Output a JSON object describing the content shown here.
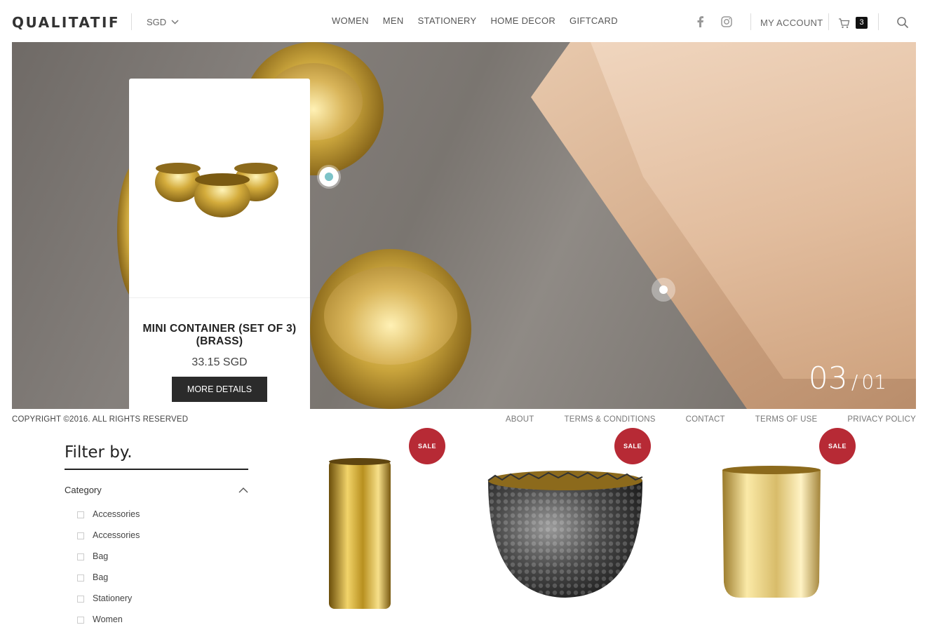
{
  "header": {
    "logo": "QUALITATIF",
    "currency": "SGD",
    "nav": [
      "WOMEN",
      "MEN",
      "STATIONERY",
      "HOME DECOR",
      "GIFTCARD"
    ],
    "account": "MY ACCOUNT",
    "cart_count": "3",
    "icons": [
      "facebook-icon",
      "instagram-icon",
      "cart-icon",
      "search-icon"
    ]
  },
  "hero": {
    "counter_current": "03",
    "counter_sep": "/",
    "counter_total": "01",
    "hotspot_colors": [
      "#7cc3c8",
      "#ffffff"
    ]
  },
  "card": {
    "title": "MINI CONTAINER (SET OF 3) (BRASS)",
    "price": "33.15 SGD",
    "button": "MORE DETAILS"
  },
  "footer": {
    "copyright": "COPYRIGHT ©2016. ALL RIGHTS RESERVED",
    "links": [
      "ABOUT",
      "TERMS & CONDITIONS",
      "CONTACT",
      "TERMS OF USE",
      "PRIVACY POLICY"
    ]
  },
  "filter": {
    "title": "Filter by.",
    "category_label": "Category",
    "categories": [
      "Accessories",
      "Accessories",
      "Bag",
      "Bag",
      "Stationery",
      "Women"
    ]
  },
  "products": [
    {
      "badge": "SALE"
    },
    {
      "badge": "SALE"
    },
    {
      "badge": "SALE"
    }
  ],
  "colors": {
    "sale": "#b72a35",
    "button": "#2b2b2b",
    "hotspot_accent": "#7cc3c8"
  }
}
